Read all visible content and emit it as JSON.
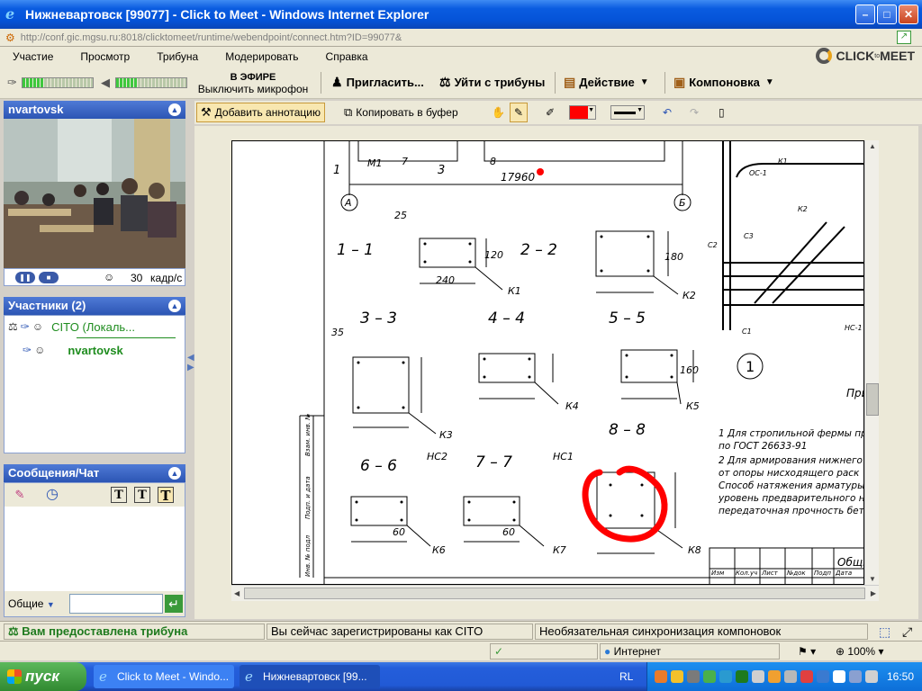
{
  "window": {
    "title": "Нижневартовск [99077] - Click to Meet - Windows Internet Explorer",
    "url": "http://conf.gic.mgsu.ru:8018/clicktomeet/runtime/webendpoint/connect.htm?ID=99077&"
  },
  "menu": [
    "Участие",
    "Просмотр",
    "Трибуна",
    "Модерировать",
    "Справка"
  ],
  "logo": {
    "text": "CLICK",
    "sup": "to",
    "text2": "MEET"
  },
  "toolbar": {
    "mic_level": 0.3,
    "speaker_level": 0.3,
    "onair_title": "В ЭФИРЕ",
    "onair_action": "Выключить микрофон",
    "invite": "Пригласить...",
    "leave_tribune": "Уйти с трибуны",
    "action": "Действие",
    "layout": "Компоновка"
  },
  "video": {
    "title": "nvartovsk",
    "fps_value": "30",
    "fps_unit": "кадр/с"
  },
  "participants": {
    "title": "Участники (2)",
    "items": [
      {
        "name": "CITO (Локаль...",
        "color": "#1e8c1e",
        "bold": false
      },
      {
        "name": "nvartovsk",
        "color": "#1e8c1e",
        "bold": true
      }
    ]
  },
  "chat": {
    "title": "Сообщения/Чат",
    "scope": "Общие",
    "input": ""
  },
  "annotation": {
    "add": "Добавить аннотацию",
    "copy": "Копировать в буфер",
    "pen_color": "#ff0000"
  },
  "drawing": {
    "sections": [
      "1 – 1",
      "2 – 2",
      "3 – 3",
      "4 – 4",
      "5 – 5",
      "6 – 6",
      "7 – 7",
      "8 – 8"
    ],
    "marks": [
      "К1",
      "К2",
      "К3",
      "К4",
      "К5",
      "К6",
      "К7",
      "К8",
      "НС1",
      "НС2",
      "М1",
      "C1",
      "C2",
      "C3",
      "К1",
      "К2",
      "ОС-1",
      "НС-1"
    ],
    "dims": [
      "25",
      "240",
      "120",
      "180",
      "35",
      "160",
      "60",
      "60",
      "17960",
      "1",
      "3",
      "7",
      "8",
      "А",
      "Б"
    ],
    "notes": [
      "1  Для стропильной фермы пр",
      "по ГОСТ 26633-91",
      "2  Для армирования нижнего п",
      "от опоры нисходящего раск",
      "Способ натяжения арматуры -",
      "уровень предварительного на",
      "передаточная прочность бетон"
    ],
    "stamp": [
      "Изм",
      "Кол.уч",
      "Лист",
      "№док",
      "Подп",
      "Дата"
    ],
    "stamp_side": [
      "Инв. № подл",
      "Подп. и дата",
      "Взам. инв. №"
    ],
    "right_label": "При",
    "common": "Общи",
    "circle_num": "1"
  },
  "app_status": {
    "tribune": "Вам предоставлена трибуна",
    "registered": "Вы сейчас зарегистрированы как CITO",
    "sync": "Необязательная синхронизация компоновок"
  },
  "ie_status": {
    "zone": "Интернет",
    "zoom": "100%"
  },
  "taskbar": {
    "start": "пуск",
    "tasks": [
      "Click to Meet - Windo...",
      "Нижневартовск [99..."
    ],
    "lang": "RL",
    "time": "16:50"
  }
}
